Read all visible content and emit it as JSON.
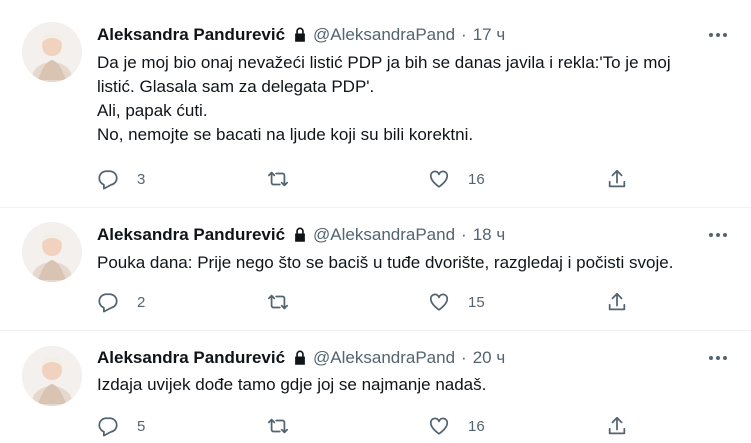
{
  "tweets": [
    {
      "author": "Aleksandra Pandurević",
      "handle": "@AleksandraPand",
      "separator": "·",
      "time": "17 ч",
      "lines": [
        "Da je moj bio onaj nevažeći listić PDP ja bih se danas javila i rekla:'To je moj",
        "listić. Glasala sam za delegata PDP'.",
        "Ali, papak ćuti.",
        "No, nemojte se bacati na ljude koji su bili korektni."
      ],
      "replies": "3",
      "retweets": "",
      "likes": "16"
    },
    {
      "author": "Aleksandra Pandurević",
      "handle": "@AleksandraPand",
      "separator": "·",
      "time": "18 ч",
      "lines": [
        "Pouka dana: Prije nego što se baciš u tuđe dvorište, razgledaj i počisti svoje."
      ],
      "replies": "2",
      "retweets": "",
      "likes": "15"
    },
    {
      "author": "Aleksandra Pandurević",
      "handle": "@AleksandraPand",
      "separator": "·",
      "time": "20 ч",
      "lines": [
        "Izdaja uvijek dođe tamo gdje joj se najmanje nadaš."
      ],
      "replies": "5",
      "retweets": "",
      "likes": "16"
    }
  ],
  "colors": {
    "text": "#0f1419",
    "secondary": "#536471",
    "divider": "#eff3f4",
    "background": "#ffffff"
  },
  "icons": {
    "lock": "lock-icon",
    "more": "more-icon",
    "reply": "reply-icon",
    "retweet": "retweet-icon",
    "like": "like-icon",
    "share": "share-icon"
  }
}
